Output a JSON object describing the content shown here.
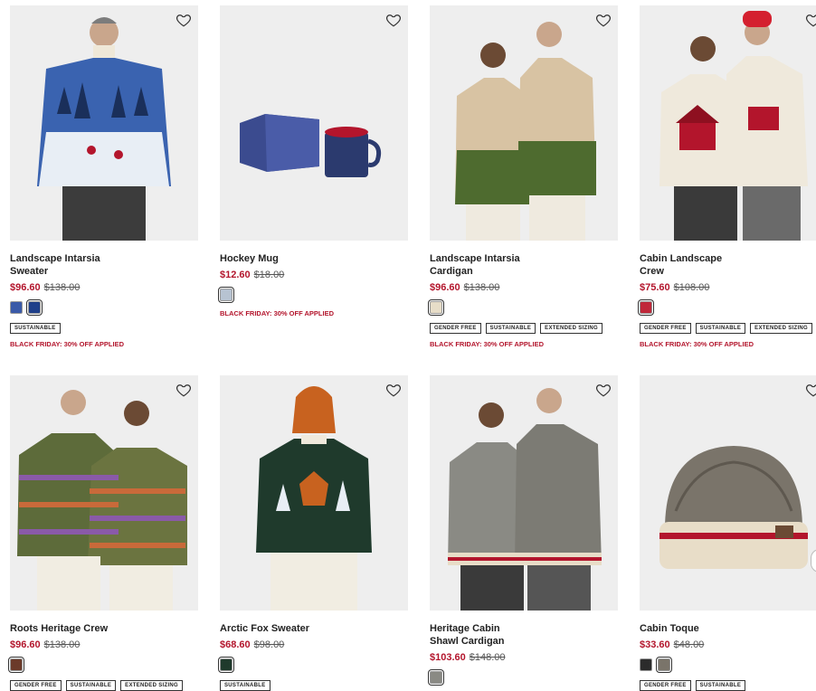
{
  "products": [
    {
      "name": "Landscape Intarsia Sweater",
      "sale_price": "$96.60",
      "orig_price": "$138.00",
      "badges": [
        "SUSTAINABLE"
      ],
      "promo": "BLACK FRIDAY: 30% OFF APPLIED",
      "swatch_colors": [
        "#3a5aa8",
        "#1f3f8a"
      ]
    },
    {
      "name": "Hockey Mug",
      "sale_price": "$12.60",
      "orig_price": "$18.00",
      "badges": [],
      "promo": "BLACK FRIDAY: 30% OFF APPLIED",
      "swatch_colors": [
        "#b7c3d1"
      ]
    },
    {
      "name": "Landscape Intarsia Cardigan",
      "sale_price": "$96.60",
      "orig_price": "$138.00",
      "badges": [
        "GENDER FREE",
        "SUSTAINABLE",
        "EXTENDED SIZING"
      ],
      "promo": "BLACK FRIDAY: 30% OFF APPLIED",
      "swatch_colors": [
        "#e7ddc8"
      ]
    },
    {
      "name": "Cabin Landscape Crew",
      "sale_price": "$75.60",
      "orig_price": "$108.00",
      "badges": [
        "GENDER FREE",
        "SUSTAINABLE",
        "EXTENDED SIZING"
      ],
      "promo": "BLACK FRIDAY: 30% OFF APPLIED",
      "swatch_colors": [
        "#c0283a"
      ]
    },
    {
      "name": "Roots Heritage Crew",
      "sale_price": "$96.60",
      "orig_price": "$138.00",
      "badges": [
        "GENDER FREE",
        "SUSTAINABLE",
        "EXTENDED SIZING"
      ],
      "promo": "",
      "swatch_colors": [
        "#6b3a2a"
      ]
    },
    {
      "name": "Arctic Fox Sweater",
      "sale_price": "$68.60",
      "orig_price": "$98.00",
      "badges": [
        "SUSTAINABLE"
      ],
      "promo": "",
      "swatch_colors": [
        "#1f3a2c"
      ]
    },
    {
      "name": "Heritage Cabin Shawl Cardigan",
      "sale_price": "$103.60",
      "orig_price": "$148.00",
      "badges": [],
      "promo": "",
      "swatch_colors": [
        "#8a8a84"
      ]
    },
    {
      "name": "Cabin Toque",
      "sale_price": "$33.60",
      "orig_price": "$48.00",
      "badges": [
        "GENDER FREE",
        "SUSTAINABLE"
      ],
      "promo": "",
      "swatch_colors": [
        "#2b2b2b",
        "#7a746a"
      ]
    }
  ],
  "colors": {
    "sale_price": "#b3152c",
    "image_bg": "#eeeeee"
  },
  "icons": {
    "wishlist": "heart-outline-icon"
  }
}
